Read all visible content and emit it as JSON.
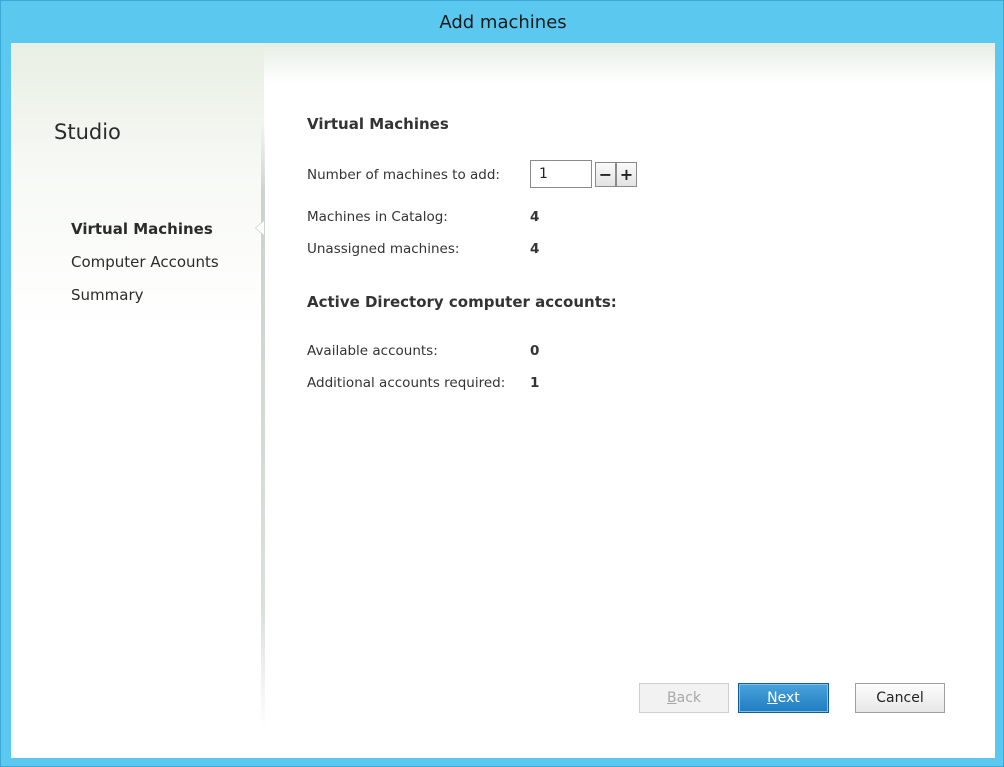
{
  "window": {
    "title": "Add machines"
  },
  "sidebar": {
    "app_name": "Studio",
    "items": [
      {
        "label": "Virtual Machines",
        "active": true
      },
      {
        "label": "Computer Accounts",
        "active": false
      },
      {
        "label": "Summary",
        "active": false
      }
    ]
  },
  "vm_section": {
    "title": "Virtual Machines",
    "machines_to_add_label": "Number of machines to add:",
    "machines_to_add_value": "1",
    "minus_label": "−",
    "plus_label": "+",
    "catalog_label": "Machines in Catalog:",
    "catalog_value": "4",
    "unassigned_label": "Unassigned machines:",
    "unassigned_value": "4"
  },
  "ad_section": {
    "title": "Active Directory computer accounts:",
    "available_label": "Available accounts:",
    "available_value": "0",
    "additional_label": "Additional accounts required:",
    "additional_value": "1"
  },
  "buttons": {
    "back_mnemonic": "B",
    "back_rest": "ack",
    "next_mnemonic": "N",
    "next_rest": "ext",
    "cancel": "Cancel"
  },
  "colors": {
    "titlebar": "#5bc8f0",
    "primary_button": "#1f7cc0"
  }
}
